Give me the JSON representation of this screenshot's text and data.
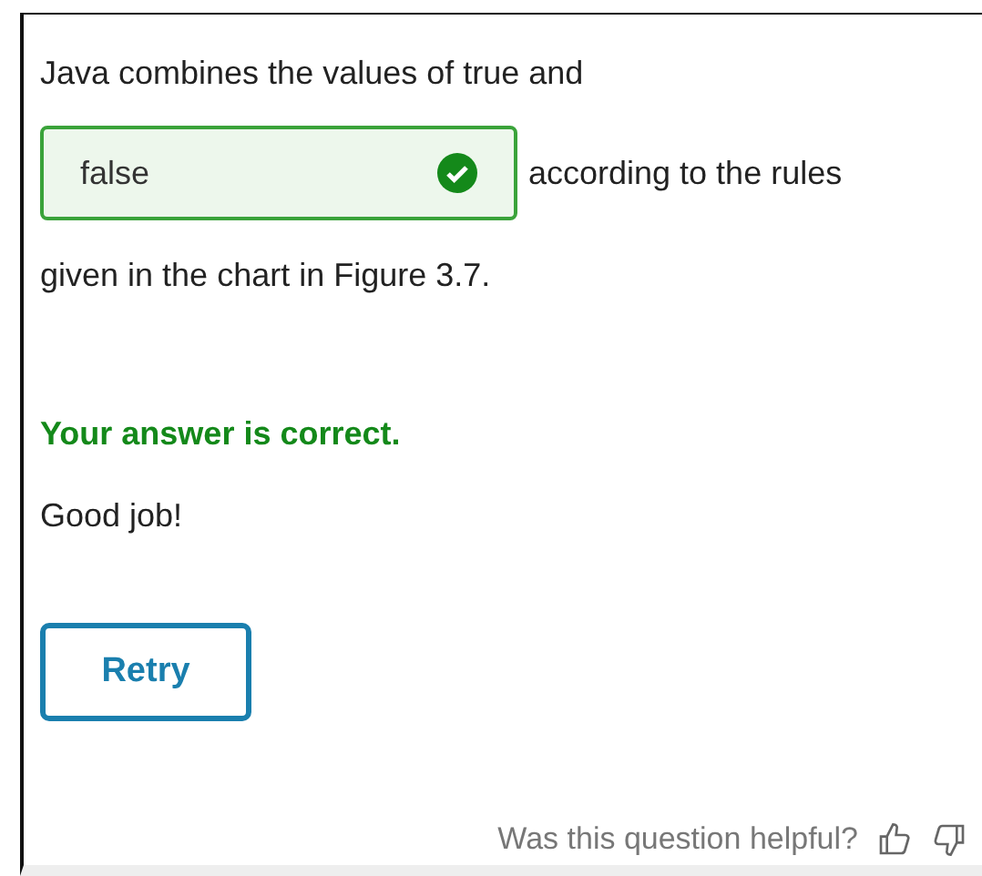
{
  "question": {
    "before": "Java combines the values of true and",
    "answer": {
      "value": "false",
      "correct": true
    },
    "after": "according to the rules",
    "end": "given in the chart in Figure 3.7."
  },
  "feedback": {
    "result": "Your answer is correct.",
    "correct": true,
    "message": "Good job!"
  },
  "buttons": [
    "Retry"
  ],
  "footer": {
    "prompt": "Was this question helpful?"
  }
}
